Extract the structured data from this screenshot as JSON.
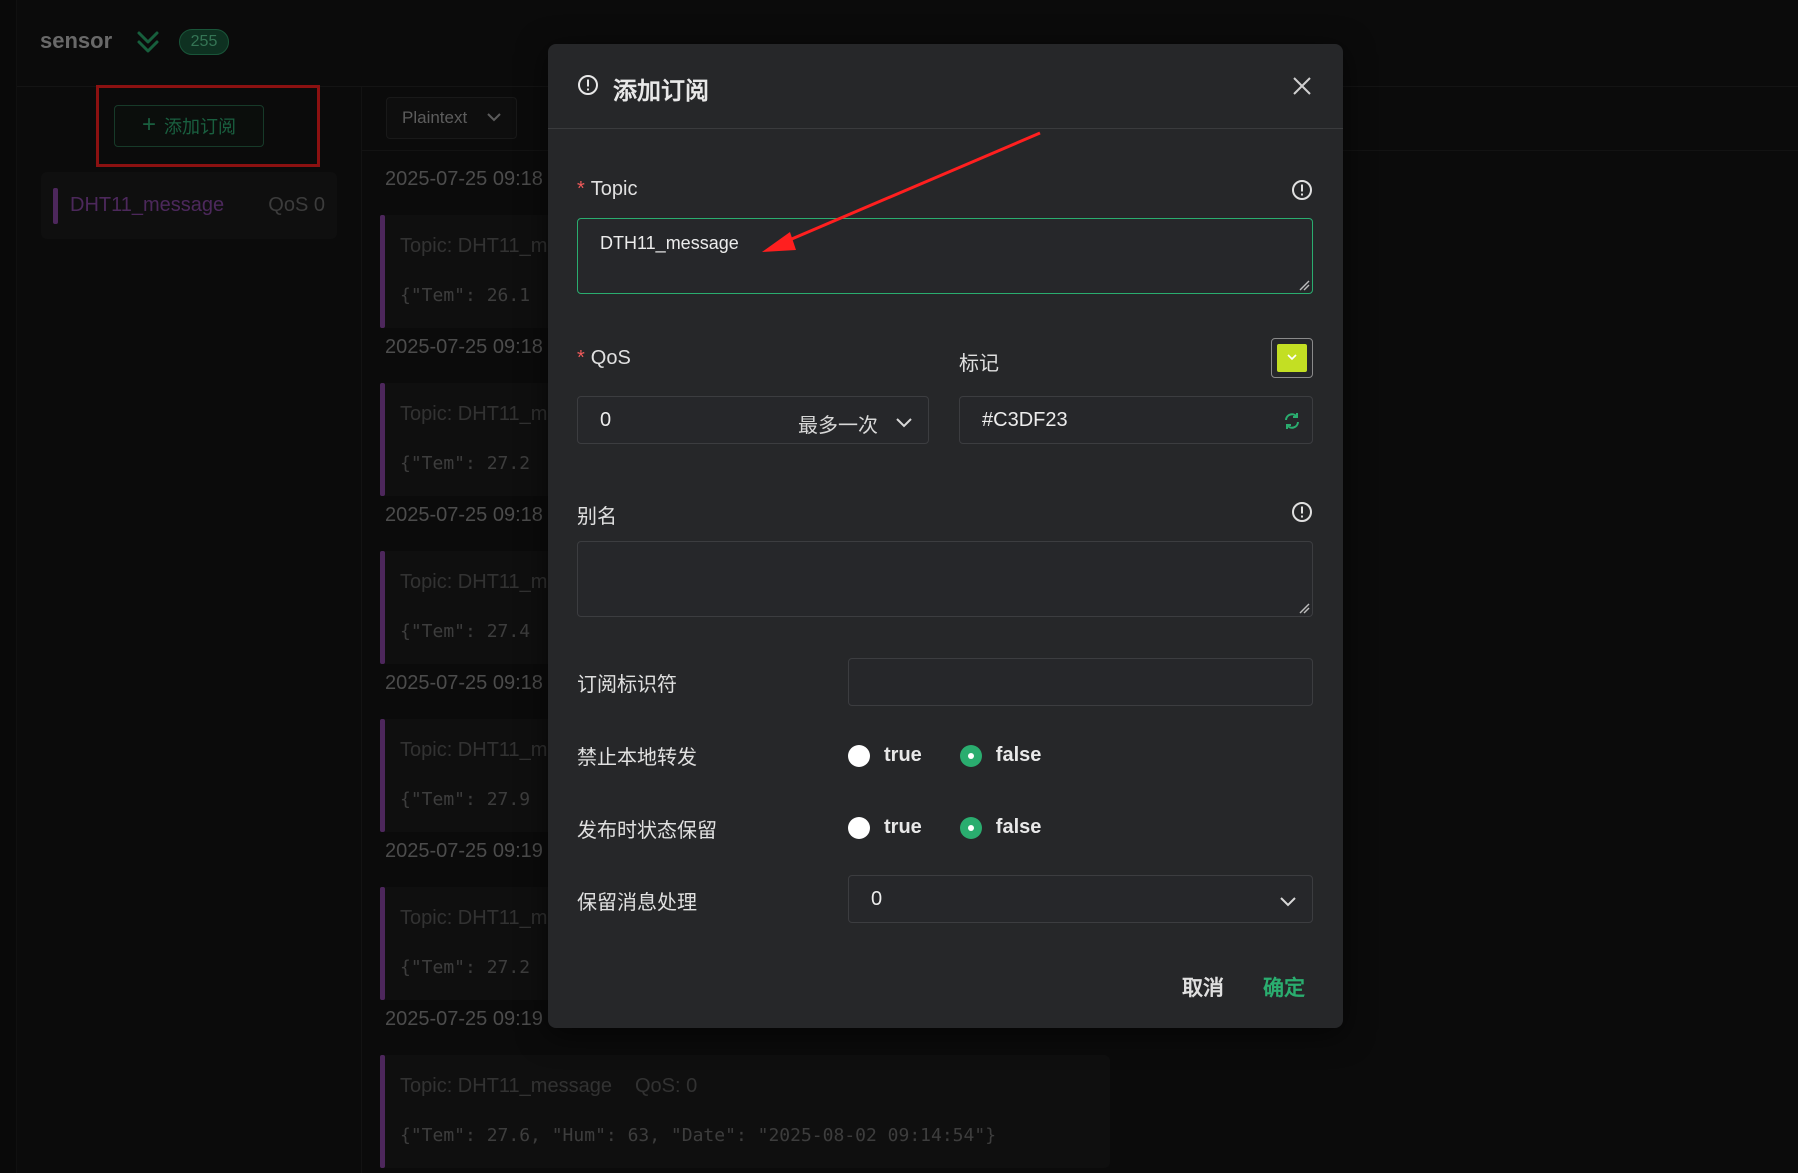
{
  "header": {
    "connection_name": "sensor",
    "count_badge": "255",
    "expand_icon": "double-chevron-down-icon"
  },
  "subscriptions": {
    "add_button_label": "添加订阅",
    "items": [
      {
        "topic": "DHT11_message",
        "qos": "QoS 0",
        "color": "#8d48a8"
      }
    ]
  },
  "message_toolbar": {
    "format_select": "Plaintext"
  },
  "messages": [
    {
      "timestamp": "2025-07-25 09:18",
      "topic": "Topic: DHT11_m",
      "payload": "{\"Tem\": 26.1"
    },
    {
      "timestamp": "2025-07-25 09:18",
      "topic": "Topic: DHT11_m",
      "payload": "{\"Tem\": 27.2"
    },
    {
      "timestamp": "2025-07-25 09:18",
      "topic": "Topic: DHT11_m",
      "payload": "{\"Tem\": 27.4"
    },
    {
      "timestamp": "2025-07-25 09:18",
      "topic": "Topic: DHT11_m",
      "payload": "{\"Tem\": 27.9"
    },
    {
      "timestamp": "2025-07-25 09:19",
      "topic": "Topic: DHT11_m",
      "payload": "{\"Tem\": 27.2"
    },
    {
      "timestamp": "2025-07-25 09:19",
      "topic": "Topic: DHT11_message",
      "qos": "QoS: 0",
      "payload": "{\"Tem\": 27.6, \"Hum\": 63, \"Date\": \"2025-08-02 09:14:54\"}"
    }
  ],
  "modal": {
    "title": "添加订阅",
    "topic": {
      "label": "Topic",
      "value": "DTH11_message"
    },
    "qos": {
      "label": "QoS",
      "value": "0",
      "suffix": "最多一次"
    },
    "color_mark": {
      "label": "标记",
      "value": "#C3DF23"
    },
    "alias": {
      "label": "别名",
      "value": ""
    },
    "sub_identifier": {
      "label": "订阅标识符",
      "value": ""
    },
    "no_local": {
      "label": "禁止本地转发",
      "options": [
        "true",
        "false"
      ],
      "selected": "false"
    },
    "retain_as_published": {
      "label": "发布时状态保留",
      "options": [
        "true",
        "false"
      ],
      "selected": "false"
    },
    "retain_handling": {
      "label": "保留消息处理",
      "value": "0"
    },
    "buttons": {
      "cancel": "取消",
      "confirm": "确定"
    }
  },
  "colors": {
    "accent": "#2aad6f",
    "subscription_bar": "#8d48a8",
    "annotation": "#ff1f1f"
  }
}
